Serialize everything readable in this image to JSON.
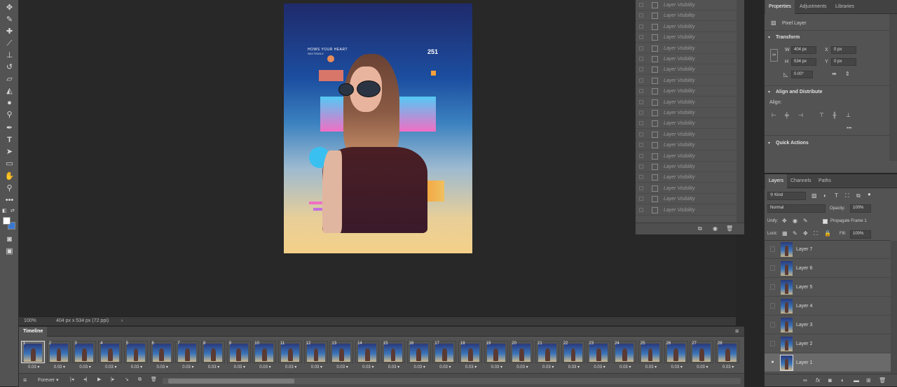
{
  "toolbar": {
    "tools": [
      "move-tool-icon",
      "eyedropper-icon",
      "healing-brush-icon",
      "brush-icon",
      "clone-stamp-icon",
      "history-brush-icon",
      "eraser-icon",
      "paint-bucket-icon",
      "blur-icon",
      "dodge-icon",
      "pen-icon",
      "type-icon",
      "path-selection-icon",
      "rectangle-icon",
      "hand-icon",
      "zoom-icon",
      "more-tools-icon"
    ],
    "type_glyph": "T"
  },
  "artboard": {
    "headline": "HOWS YOUR HEART",
    "sub_headline": "WAS FEMALE",
    "number": "251",
    "colors": {
      "top": "#1f2a6b",
      "mid": "#3c82c0",
      "bottom": "#f4d088",
      "pink": "#f26ec4",
      "cyan": "#54c9f5",
      "orange": "#f5a23a",
      "coral": "#d9766a"
    }
  },
  "status": {
    "zoom": "100%",
    "doc_info": "404 px x 534 px (72 ppi)",
    "arrow": "›"
  },
  "history": {
    "item_label": "Layer Visibility",
    "count": 20
  },
  "properties": {
    "tabs": [
      "Properties",
      "Adjustments",
      "Libraries"
    ],
    "layer_kind": "Pixel Layer",
    "transform_header": "Transform",
    "w_label": "W",
    "w_value": "404 px",
    "x_label": "X",
    "x_value": "0 px",
    "h_label": "H",
    "h_value": "534 px",
    "y_label": "Y",
    "y_value": "0 px",
    "angle_value": "0.00°",
    "align_header": "Align and Distribute",
    "align_label": "Align:",
    "more": "•••",
    "quick_actions_header": "Quick Actions"
  },
  "layers_panel": {
    "tabs": [
      "Layers",
      "Channels",
      "Paths"
    ],
    "kind_filter": "Kind",
    "blend_mode": "Normal",
    "opacity_label": "Opacity:",
    "opacity_value": "100%",
    "unify_label": "Unify:",
    "propagate_label": "Propagate Frame 1",
    "lock_label": "Lock:",
    "fill_label": "Fill:",
    "fill_value": "100%",
    "layers": [
      "Layer 7",
      "Layer 6",
      "Layer 5",
      "Layer 4",
      "Layer 3",
      "Layer 2",
      "Layer 1"
    ],
    "visible_eye": "●",
    "footer_icons": [
      "link-icon",
      "fx-icon",
      "mask-icon",
      "adjustment-icon",
      "group-icon",
      "new-layer-icon",
      "trash-icon"
    ],
    "fx_glyph": "fx"
  },
  "timeline": {
    "title": "Timeline",
    "menu_glyph": "≡",
    "frames": [
      "1",
      "2",
      "3",
      "4",
      "5",
      "6",
      "7",
      "8",
      "9",
      "10",
      "11",
      "12",
      "13",
      "14",
      "15",
      "16",
      "17",
      "18",
      "19",
      "20",
      "21",
      "22",
      "23",
      "24",
      "25",
      "26",
      "27",
      "28"
    ],
    "delay": "0.03",
    "loop": "Forever",
    "selected_frame": 1,
    "controls": [
      "convert-icon",
      "first-frame-icon",
      "previous-frame-icon",
      "play-icon",
      "next-frame-icon",
      "tween-icon",
      "duplicate-frame-icon",
      "delete-frame-icon"
    ],
    "glyphs": {
      "convert": "≡",
      "first": "|◂",
      "prev": "◂|",
      "play": "▶",
      "next": "|▸",
      "tween": "↘",
      "duplicate": "⧉",
      "delete": "🗑"
    }
  }
}
